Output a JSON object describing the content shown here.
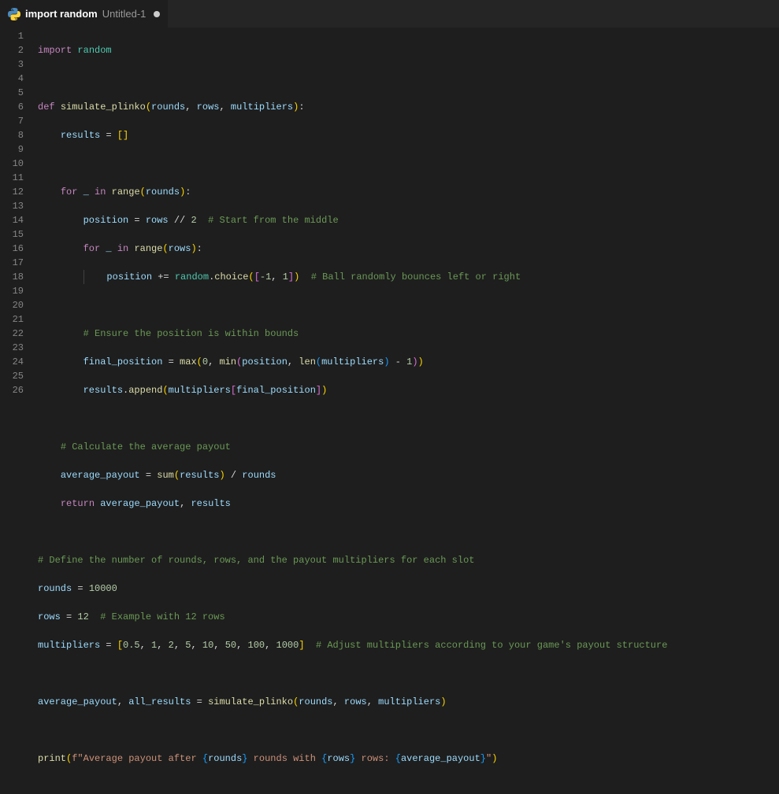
{
  "tab": {
    "title": "import random",
    "subtitle": "Untitled-1",
    "language_icon": "python-icon",
    "dirty": true
  },
  "gutter": {
    "start": 1,
    "end": 26
  },
  "code": {
    "l1": {
      "kw1": "import",
      "mod": "random"
    },
    "l3": {
      "kw": "def",
      "fn": "simulate_plinko",
      "p1": "rounds",
      "p2": "rows",
      "p3": "multipliers"
    },
    "l4": {
      "var": "results",
      "op": "=",
      "br": "[]"
    },
    "l6": {
      "kw1": "for",
      "var": "_",
      "kw2": "in",
      "fn": "range",
      "arg": "rounds"
    },
    "l7": {
      "var": "position",
      "op": "=",
      "v2": "rows",
      "op2": "//",
      "num": "2",
      "cmt": "# Start from the middle"
    },
    "l8": {
      "kw1": "for",
      "var": "_",
      "kw2": "in",
      "fn": "range",
      "arg": "rows"
    },
    "l9": {
      "var": "position",
      "op": "+=",
      "mod": "random",
      "fn": "choice",
      "n1": "-1",
      "n2": "1",
      "cmt": "# Ball randomly bounces left or right"
    },
    "l11": {
      "cmt": "# Ensure the position is within bounds"
    },
    "l12": {
      "var": "final_position",
      "op": "=",
      "fn1": "max",
      "n1": "0",
      "fn2": "min",
      "arg2": "position",
      "fn3": "len",
      "arg3": "multipliers",
      "op2": "-",
      "n2": "1"
    },
    "l13": {
      "var": "results",
      "fn": "append",
      "arg1": "multipliers",
      "arg2": "final_position"
    },
    "l15": {
      "cmt": "# Calculate the average payout"
    },
    "l16": {
      "var": "average_payout",
      "op": "=",
      "fn": "sum",
      "arg": "results",
      "op2": "/",
      "v2": "rounds"
    },
    "l17": {
      "kw": "return",
      "v1": "average_payout",
      "v2": "results"
    },
    "l19": {
      "cmt": "# Define the number of rounds, rows, and the payout multipliers for each slot"
    },
    "l20": {
      "var": "rounds",
      "op": "=",
      "num": "10000"
    },
    "l21": {
      "var": "rows",
      "op": "=",
      "num": "12",
      "cmt": "# Example with 12 rows"
    },
    "l22": {
      "var": "multipliers",
      "op": "=",
      "n1": "0.5",
      "n2": "1",
      "n3": "2",
      "n4": "5",
      "n5": "10",
      "n6": "50",
      "n7": "100",
      "n8": "1000",
      "cmt": "# Adjust multipliers according to your game's payout structure"
    },
    "l24": {
      "v1": "average_payout",
      "v2": "all_results",
      "op": "=",
      "fn": "simulate_plinko",
      "a1": "rounds",
      "a2": "rows",
      "a3": "multipliers"
    },
    "l26": {
      "fn": "print",
      "s1": "f\"Average payout after ",
      "e1": "rounds",
      "s2": " rounds with ",
      "e2": "rows",
      "s3": " rows: ",
      "e3": "average_payout",
      "s4": "\""
    }
  }
}
